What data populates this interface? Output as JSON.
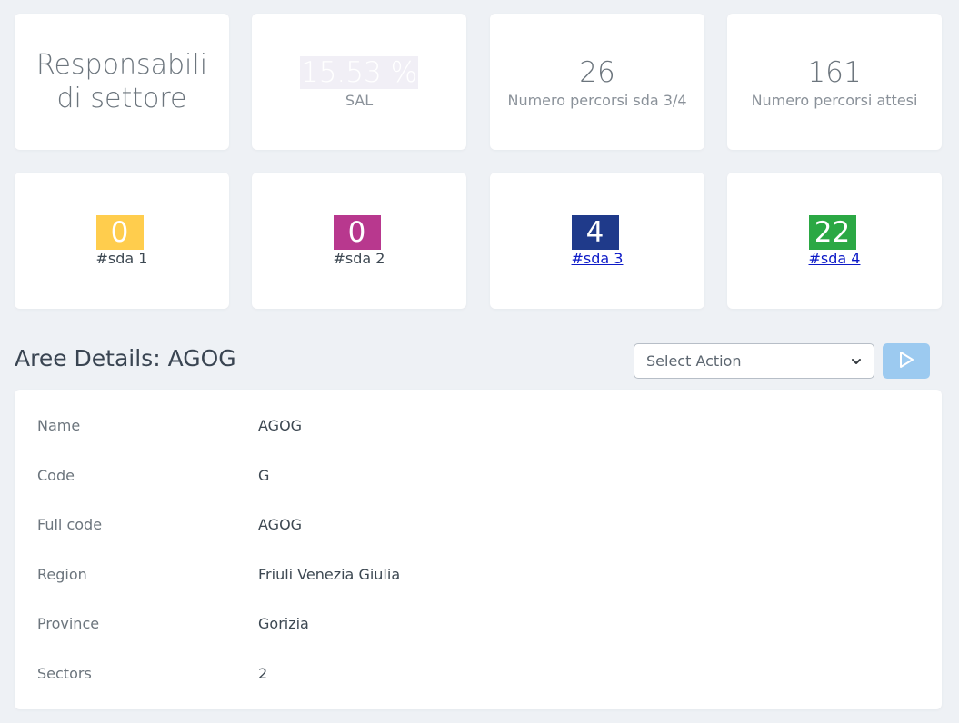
{
  "stats": {
    "responsabili_title": "Responsabili di settore",
    "sal": {
      "value": "15.53 %",
      "label": "SAL"
    },
    "percorsi_sda": {
      "value": "26",
      "label": "Numero percorsi sda 3/4"
    },
    "percorsi_attesi": {
      "value": "161",
      "label": "Numero percorsi attesi"
    }
  },
  "sda": [
    {
      "count": "0",
      "label": "#sda 1",
      "color": "#ffcd4d",
      "link": false
    },
    {
      "count": "0",
      "label": "#sda 2",
      "color": "#b8388e",
      "link": false
    },
    {
      "count": "4",
      "label": "#sda 3",
      "color": "#1f3a8a",
      "link": true
    },
    {
      "count": "22",
      "label": "#sda 4",
      "color": "#2ba844",
      "link": true
    }
  ],
  "section": {
    "title": "Aree Details: AGOG",
    "select_placeholder": "Select Action"
  },
  "details": [
    {
      "key": "Name",
      "value": "AGOG"
    },
    {
      "key": "Code",
      "value": "G"
    },
    {
      "key": "Full code",
      "value": "AGOG"
    },
    {
      "key": "Region",
      "value": "Friuli Venezia Giulia"
    },
    {
      "key": "Province",
      "value": "Gorizia"
    },
    {
      "key": "Sectors",
      "value": "2"
    }
  ],
  "icons": {
    "select_chevron": "chevron-down-icon",
    "run_button": "play-icon"
  }
}
